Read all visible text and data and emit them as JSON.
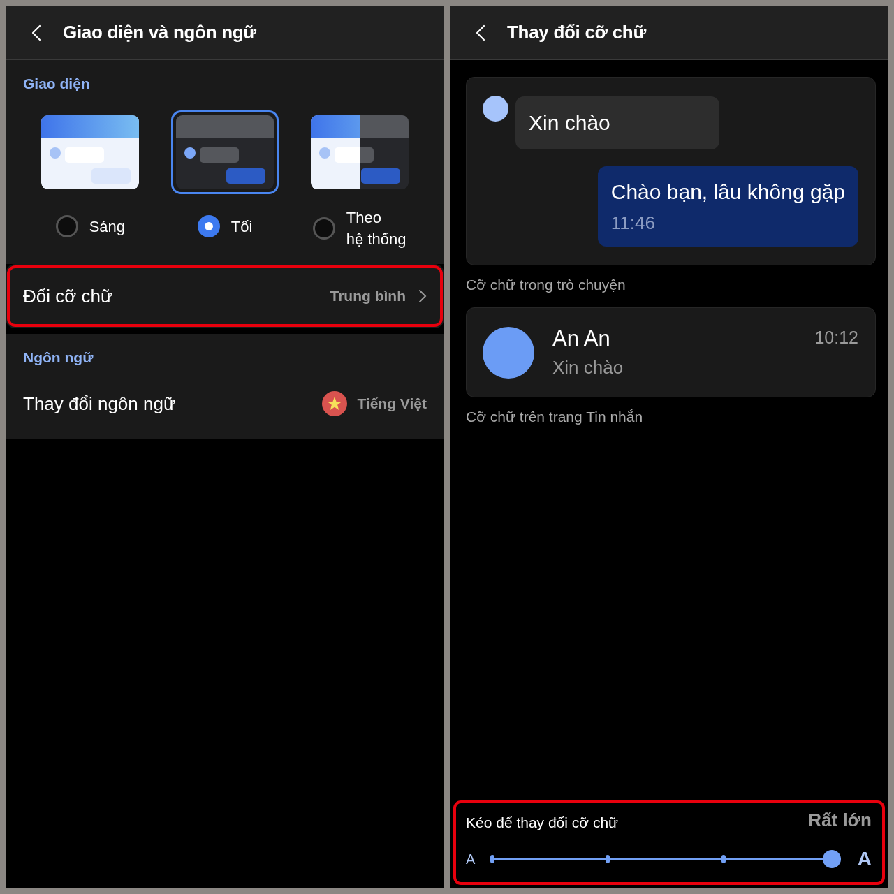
{
  "panels": [
    {
      "kind": "settings",
      "header": {
        "title": "Giao diện và ngôn ngữ"
      },
      "appearance": {
        "heading": "Giao diện",
        "themes": [
          {
            "kind": "light",
            "label": "Sáng",
            "selected": false
          },
          {
            "kind": "dark",
            "label": "Tối",
            "selected": true
          },
          {
            "kind": "system",
            "label": "Theo\nhệ thống",
            "selected": false
          }
        ]
      },
      "font_row": {
        "label": "Đổi cỡ chữ",
        "value": "Trung bình",
        "highlighted": true
      },
      "language": {
        "heading": "Ngôn ngữ",
        "row": {
          "label": "Thay đổi ngôn ngữ",
          "value": "Tiếng Việt"
        }
      }
    },
    {
      "kind": "font_size",
      "header": {
        "title": "Thay đổi cỡ chữ"
      },
      "chat_preview": {
        "incoming": "Xin chào",
        "outgoing": "Chào bạn, lâu không gặp",
        "outgoing_time": "11:46"
      },
      "chat_caption": "Cỡ chữ trong trò chuyện",
      "list_preview": {
        "name": "An An",
        "message": "Xin chào",
        "time": "10:12"
      },
      "list_caption": "Cỡ chữ trên trang Tin nhắn",
      "slider": {
        "label": "Kéo để thay đổi cỡ chữ",
        "value": "Rất lớn",
        "min_label": "A",
        "max_label": "A",
        "level": 1,
        "highlighted": true
      }
    }
  ]
}
